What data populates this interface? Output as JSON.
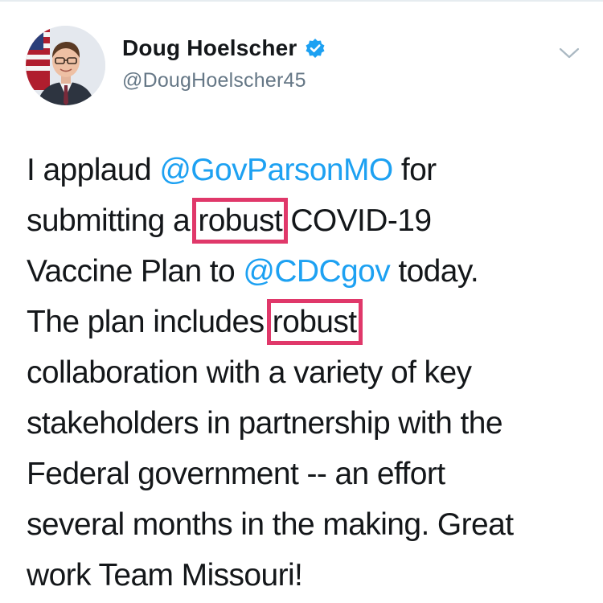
{
  "author": {
    "display_name": "Doug Hoelscher",
    "handle": "@DougHoelscher45",
    "verified": true,
    "avatar_icon": "profile-photo"
  },
  "menu_icon": "chevron-down-icon",
  "tweet": {
    "lines": [
      [
        {
          "t": "I applaud "
        },
        {
          "t": "@GovParsonMO",
          "kind": "mention"
        },
        {
          "t": " for"
        }
      ],
      [
        {
          "t": "submitting a "
        },
        {
          "t": "robust",
          "kind": "highlight"
        },
        {
          "t": " COVID-19"
        }
      ],
      [
        {
          "t": "Vaccine Plan to "
        },
        {
          "t": "@CDCgov",
          "kind": "mention"
        },
        {
          "t": " today."
        }
      ],
      [
        {
          "t": "The plan includes "
        },
        {
          "t": "robust",
          "kind": "highlight"
        }
      ],
      [
        {
          "t": "collaboration with a variety of key"
        }
      ],
      [
        {
          "t": "stakeholders in partnership with the"
        }
      ],
      [
        {
          "t": "Federal government -- an effort"
        }
      ],
      [
        {
          "t": "several months in the making. Great"
        }
      ],
      [
        {
          "t": "work Team Missouri!"
        }
      ]
    ]
  },
  "colors": {
    "mention": "#1da1f2",
    "highlight_box": "#e0386a",
    "verified_badge": "#1da1f2",
    "text": "#14171a",
    "muted": "#657786"
  }
}
